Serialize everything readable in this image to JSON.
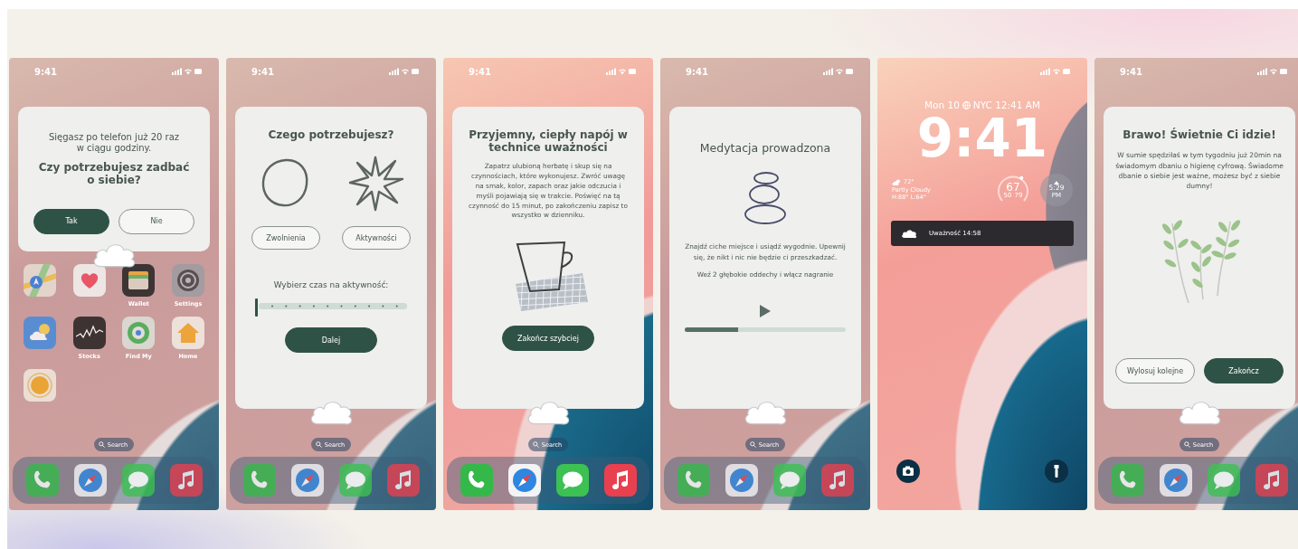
{
  "phones": [
    {
      "kind": "home",
      "dimmed": true,
      "status_time": "9:41",
      "card": {
        "kind": "prompt",
        "text": "Sięgasz po telefon już 20 raz w ciągu godziny.",
        "question": "Czy potrzebujesz zadbać o siebie?",
        "buttons": [
          {
            "label": "Tak",
            "kind": "filled"
          },
          {
            "label": "Nie",
            "kind": "outline"
          }
        ]
      },
      "apps": [
        {
          "kind": "maps"
        },
        {
          "kind": "health"
        },
        {
          "kind": "wallet",
          "label": "Wallet"
        },
        {
          "kind": "settings",
          "label": "Settings"
        },
        {
          "kind": "weather"
        },
        {
          "kind": "stocks",
          "label": "Stocks"
        },
        {
          "kind": "findmy",
          "label": "Find My"
        },
        {
          "kind": "home",
          "label": "Home"
        },
        {
          "kind": "sun"
        }
      ],
      "search": "Search",
      "dock": [
        {
          "kind": "phone"
        },
        {
          "kind": "safari"
        },
        {
          "kind": "messages"
        },
        {
          "kind": "music"
        }
      ]
    },
    {
      "kind": "home",
      "dimmed": true,
      "status_time": "9:41",
      "card": {
        "kind": "choice",
        "title": "Czego potrzebujesz?",
        "options": [
          {
            "label": "Zwolnienia",
            "kind": "circle"
          },
          {
            "label": "Aktywności",
            "kind": "star"
          }
        ],
        "subtitle": "Wybierz czas na aktywność:",
        "slider": {
          "level": 0
        },
        "buttons": [
          {
            "label": "Dalej",
            "kind": "filled"
          }
        ]
      },
      "search": "Search",
      "dock": [
        {
          "kind": "phone"
        },
        {
          "kind": "safari"
        },
        {
          "kind": "messages"
        },
        {
          "kind": "music"
        }
      ]
    },
    {
      "kind": "home",
      "dimmed": false,
      "status_time": "9:41",
      "card": {
        "kind": "activity",
        "title": "Przyjemny, ciepły napój w technice uważności",
        "text": "Zapatrz ulubioną herbatę i skup się na czynnościach, które wykonujesz. Zwróć uwagę na smak, kolor, zapach oraz jakie odczucia i myśli pojawiają się w trakcie. Poświęć na tą czynność do 15 minut, po zakończeniu zapisz to wszystko w dzienniku.",
        "buttons": [
          {
            "label": "Zakończ szybciej",
            "kind": "filled"
          }
        ]
      },
      "search": "Search",
      "dock": [
        {
          "kind": "phone"
        },
        {
          "kind": "safari"
        },
        {
          "kind": "messages"
        },
        {
          "kind": "music"
        }
      ]
    },
    {
      "kind": "home",
      "dimmed": true,
      "status_time": "9:41",
      "card": {
        "kind": "meditation",
        "title": "Medytacja prowadzona",
        "paragraphs": [
          "Znajdź ciche miejsce i usiądź wygodnie. Upewnij się, że nikt i nic nie będzie ci przeszkadzać.",
          "Weź 2 głębokie oddechy i włącz nagranie"
        ],
        "progress": {
          "level": 0.33
        }
      },
      "search": "Search",
      "dock": [
        {
          "kind": "phone"
        },
        {
          "kind": "safari"
        },
        {
          "kind": "messages"
        },
        {
          "kind": "music"
        }
      ]
    },
    {
      "kind": "lock",
      "dimmed": false,
      "date": "Mon 10",
      "city_time": "NYC 12:41 AM",
      "time": "9:41",
      "weather": {
        "temp": "72°",
        "condition": "Partly Cloudy",
        "range": "H:88° L:64°"
      },
      "gauge": {
        "value": "67",
        "min": "50",
        "max": "79"
      },
      "sunset": {
        "time": "5:29",
        "period": "PM"
      },
      "notification": {
        "text": "Uważność 14:58"
      }
    },
    {
      "kind": "home",
      "dimmed": true,
      "status_time": "9:41",
      "card": {
        "kind": "reward",
        "title": "Brawo! Świetnie Ci idzie!",
        "text": "W sumie spędziłaś w tym tygodniu już 20min na świadomym dbaniu o higienę cyfrową. Świadome dbanie o siebie jest ważne, możesz być z siebie dumny!",
        "buttons": [
          {
            "label": "Wylosuj kolejne",
            "kind": "outline"
          },
          {
            "label": "Zakończ",
            "kind": "filled"
          }
        ]
      },
      "search": "Search",
      "dock": [
        {
          "kind": "phone"
        },
        {
          "kind": "safari"
        },
        {
          "kind": "messages"
        },
        {
          "kind": "music"
        }
      ]
    }
  ]
}
